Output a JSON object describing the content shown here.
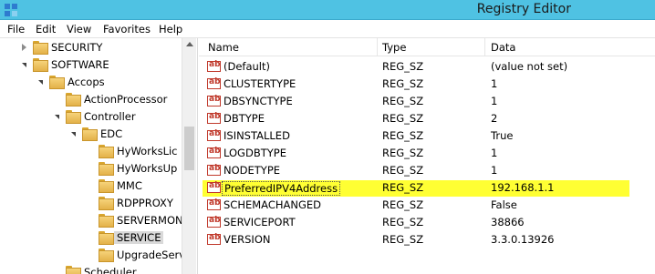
{
  "window": {
    "title": "Registry Editor"
  },
  "menu": [
    "File",
    "Edit",
    "View",
    "Favorites",
    "Help"
  ],
  "tree": [
    {
      "label": "SECURITY",
      "depth": 1,
      "state": "collapsed"
    },
    {
      "label": "SOFTWARE",
      "depth": 1,
      "state": "expanded"
    },
    {
      "label": "Accops",
      "depth": 2,
      "state": "expanded"
    },
    {
      "label": "ActionProcessor",
      "depth": 3,
      "state": "none"
    },
    {
      "label": "Controller",
      "depth": 3,
      "state": "expanded"
    },
    {
      "label": "EDC",
      "depth": 4,
      "state": "expanded"
    },
    {
      "label": "HyWorksLic",
      "depth": 5,
      "state": "none"
    },
    {
      "label": "HyWorksUp",
      "depth": 5,
      "state": "none"
    },
    {
      "label": "MMC",
      "depth": 5,
      "state": "none"
    },
    {
      "label": "RDPPROXY",
      "depth": 5,
      "state": "none"
    },
    {
      "label": "SERVERMON",
      "depth": 5,
      "state": "none"
    },
    {
      "label": "SERVICE",
      "depth": 5,
      "state": "none",
      "selected": true
    },
    {
      "label": "UpgradeServ",
      "depth": 5,
      "state": "none"
    },
    {
      "label": "Scheduler",
      "depth": 3,
      "state": "none"
    }
  ],
  "columns": {
    "name": "Name",
    "type": "Type",
    "data": "Data"
  },
  "values": [
    {
      "name": "(Default)",
      "type": "REG_SZ",
      "data": "(value not set)"
    },
    {
      "name": "CLUSTERTYPE",
      "type": "REG_SZ",
      "data": "1"
    },
    {
      "name": "DBSYNCTYPE",
      "type": "REG_SZ",
      "data": "1"
    },
    {
      "name": "DBTYPE",
      "type": "REG_SZ",
      "data": "2"
    },
    {
      "name": "ISINSTALLED",
      "type": "REG_SZ",
      "data": "True"
    },
    {
      "name": "LOGDBTYPE",
      "type": "REG_SZ",
      "data": "1"
    },
    {
      "name": "NODETYPE",
      "type": "REG_SZ",
      "data": "1"
    },
    {
      "name": "PreferredIPV4Address",
      "type": "REG_SZ",
      "data": "192.168.1.1",
      "highlighted": true
    },
    {
      "name": "SCHEMACHANGED",
      "type": "REG_SZ",
      "data": "False"
    },
    {
      "name": "SERVICEPORT",
      "type": "REG_SZ",
      "data": "38866"
    },
    {
      "name": "VERSION",
      "type": "REG_SZ",
      "data": "3.3.0.13926"
    }
  ],
  "icons": {
    "app": "registry-editor-icon",
    "value": "string-value-icon"
  },
  "colors": {
    "titlebar": "#4fc2e3",
    "highlight": "#ffff33",
    "selected": "#d9d9d9"
  }
}
